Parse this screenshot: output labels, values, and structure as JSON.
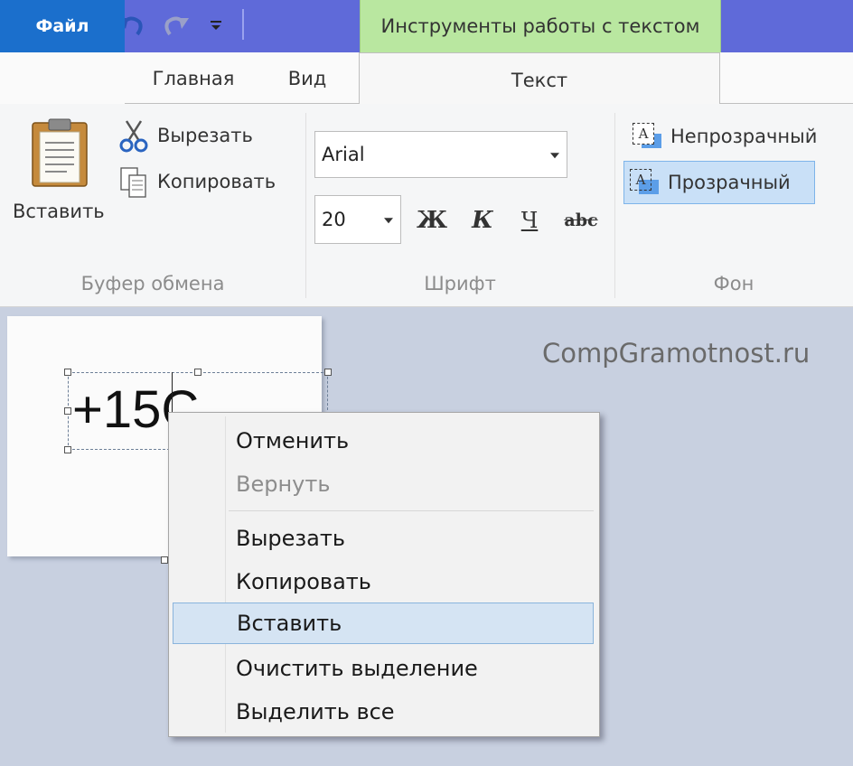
{
  "title_bar": {
    "context_tab_label": "Инструменты работы с текстом"
  },
  "tabs": [
    {
      "label": "Файл"
    },
    {
      "label": "Главная"
    },
    {
      "label": "Вид"
    },
    {
      "label": "Текст"
    }
  ],
  "clipboard": {
    "paste_label": "Вставить",
    "cut_label": "Вырезать",
    "copy_label": "Копировать",
    "group_label": "Буфер обмена"
  },
  "font": {
    "family": "Arial",
    "size": "20",
    "bold_glyph": "Ж",
    "italic_glyph": "К",
    "underline_glyph": "Ч",
    "strike_glyph": "abc",
    "group_label": "Шрифт"
  },
  "background": {
    "opaque_label": "Непрозрачный",
    "transparent_label": "Прозрачный",
    "selected": "Прозрачный",
    "group_label": "Фон"
  },
  "canvas": {
    "text": "+15C",
    "watermark": "CompGramotnost.ru"
  },
  "context_menu": {
    "items": [
      {
        "label": "Отменить",
        "enabled": true
      },
      {
        "label": "Вернуть",
        "enabled": false
      },
      {
        "label": "Вырезать",
        "enabled": true
      },
      {
        "label": "Копировать",
        "enabled": true
      },
      {
        "label": "Вставить",
        "enabled": true,
        "highlighted": true
      },
      {
        "label": "Очистить выделение",
        "enabled": true
      },
      {
        "label": "Выделить все",
        "enabled": true
      }
    ]
  },
  "colors": {
    "title_bar": "#5f6ad9",
    "context_tab": "#b9e7a0",
    "file_tab": "#1b6fcc",
    "highlight": "#d5e4f3"
  }
}
